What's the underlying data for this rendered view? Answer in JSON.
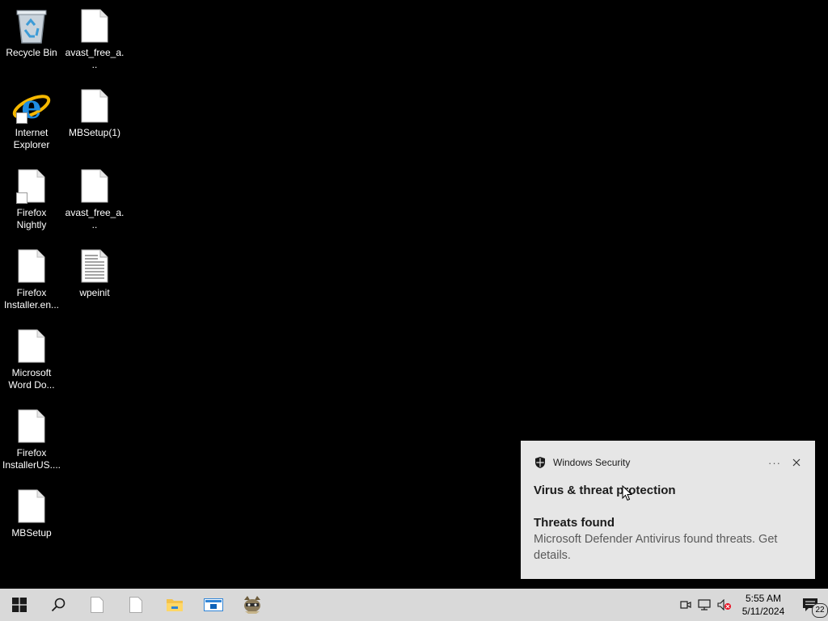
{
  "desktop": {
    "icons": [
      {
        "label": "Recycle Bin",
        "icon": "recycle-bin-icon",
        "shortcut": false
      },
      {
        "label": "avast_free_a...",
        "icon": "blank-file-icon",
        "shortcut": false
      },
      {
        "label": "Internet Explorer",
        "icon": "internet-explorer-icon",
        "shortcut": true
      },
      {
        "label": "MBSetup(1)",
        "icon": "blank-file-icon",
        "shortcut": false
      },
      {
        "label": "Firefox Nightly",
        "icon": "blank-file-icon",
        "shortcut": true
      },
      {
        "label": "avast_free_a...",
        "icon": "blank-file-icon",
        "shortcut": false
      },
      {
        "label": "Firefox Installer.en...",
        "icon": "blank-file-icon",
        "shortcut": false
      },
      {
        "label": "wpeinit",
        "icon": "text-file-icon",
        "shortcut": false
      },
      {
        "label": "Microsoft Word Do...",
        "icon": "blank-file-icon",
        "shortcut": false
      },
      {
        "label": "Firefox InstallerUS....",
        "icon": "blank-file-icon",
        "shortcut": false
      },
      {
        "label": "MBSetup",
        "icon": "blank-file-icon",
        "shortcut": false
      }
    ]
  },
  "toast": {
    "app_name": "Windows Security",
    "more_label": "···",
    "title": "Virus & threat protection",
    "subtitle": "Threats found",
    "body": "Microsoft Defender Antivirus found threats. Get details."
  },
  "taskbar": {
    "buttons": [
      "start-icon",
      "search-icon",
      "blank-file-icon",
      "blank-file-icon",
      "file-explorer-icon",
      "app-window-icon",
      "raccoon-app-icon"
    ]
  },
  "tray": {
    "time": "5:55 AM",
    "date": "5/11/2024",
    "notification_count": "22"
  },
  "colors": {
    "desktop_bg": "#000000",
    "taskbar_bg": "#d9d9d9",
    "toast_bg": "#e6e6e6",
    "windows_blue": "#0078d7"
  }
}
